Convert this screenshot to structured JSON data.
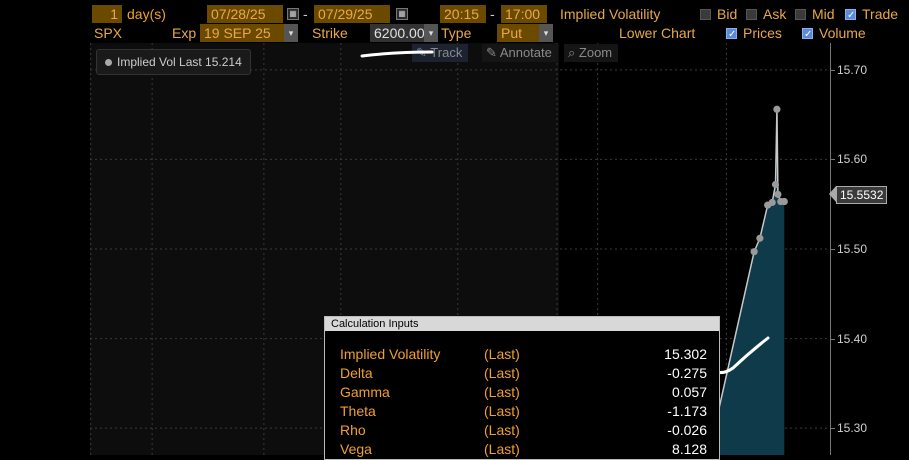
{
  "toolbar": {
    "period_value": "1",
    "period_unit": "day(s)",
    "date_start": "07/28/25",
    "date_sep": "-",
    "date_end": "07/29/25",
    "time_start": "20:15",
    "time_sep": "-",
    "time_end": "17:00",
    "series_label": "Implied Volatility",
    "bid_label": "Bid",
    "ask_label": "Ask",
    "mid_label": "Mid",
    "trade_label": "Trade",
    "bid_checked": false,
    "ask_checked": false,
    "mid_checked": false,
    "trade_checked": true
  },
  "row2": {
    "ticker": "SPX",
    "exp_label": "Exp",
    "exp_value": "19 SEP 25",
    "strike_label": "Strike",
    "strike_value": "6200.00",
    "type_label": "Type",
    "type_value": "Put",
    "lower_chart_label": "Lower Chart",
    "prices_label": "Prices",
    "volume_label": "Volume",
    "prices_checked": true,
    "volume_checked": true
  },
  "chart_tools": {
    "track": "Track",
    "annotate": "Annotate",
    "zoom": "Zoom"
  },
  "legend": {
    "text": "Implied Vol Last 15.214"
  },
  "y_axis": {
    "ticks": [
      "15.70",
      "15.60",
      "15.50",
      "15.40",
      "15.30"
    ],
    "current_value": "15.5532"
  },
  "chart_data": {
    "type": "area",
    "title": "",
    "ylim": [
      15.27,
      15.73
    ],
    "grid": true,
    "series": [
      {
        "name": "Implied Vol Last",
        "x": [
          0,
          1,
          2,
          3,
          4,
          5,
          6,
          7,
          8,
          9
        ],
        "values": [
          15.302,
          15.497,
          15.512,
          15.549,
          15.552,
          15.572,
          15.656,
          15.561,
          15.553,
          15.553
        ]
      }
    ],
    "x_pos": [
      0.0,
      0.356,
      0.408,
      0.479,
      0.52,
      0.55,
      0.563,
      0.572,
      0.598,
      0.63
    ]
  },
  "calc_inputs": {
    "title": "Calculation Inputs",
    "rows": [
      {
        "name": "Implied Volatility",
        "kind": "(Last)",
        "value": "15.302"
      },
      {
        "name": "Delta",
        "kind": "(Last)",
        "value": "-0.275"
      },
      {
        "name": "Gamma",
        "kind": "(Last)",
        "value": "0.057"
      },
      {
        "name": "Theta",
        "kind": "(Last)",
        "value": "-1.173"
      },
      {
        "name": "Rho",
        "kind": "(Last)",
        "value": "-0.026"
      },
      {
        "name": "Vega",
        "kind": "(Last)",
        "value": "8.128"
      }
    ]
  },
  "colors": {
    "accent": "#f0a030",
    "area_fill": "#0e3a4a",
    "line": "#c8c8c8",
    "current_value_bg": "#3a3a3a"
  }
}
